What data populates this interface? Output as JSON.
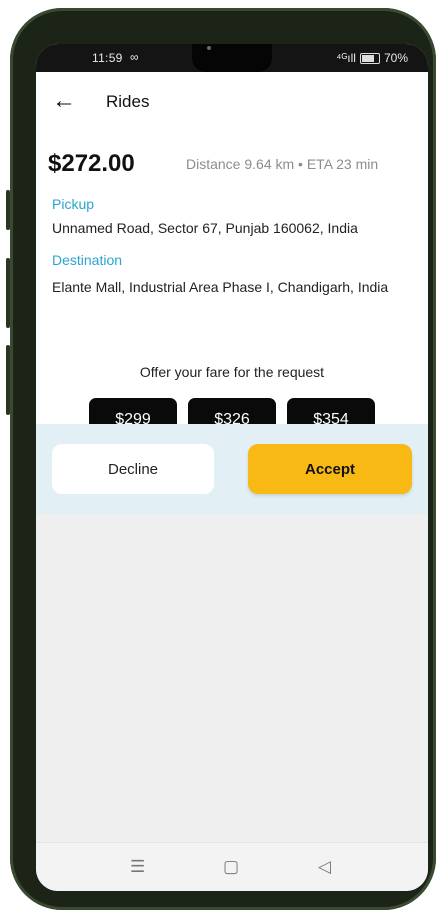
{
  "status_bar": {
    "time": "11:59",
    "extra": "∞",
    "signal": "⁴ᴳıll",
    "battery": "70%"
  },
  "header": {
    "title": "Rides"
  },
  "ride": {
    "price": "$272.00",
    "meta": "Distance 9.64 km • ETA 23 min",
    "pickup_label": "Pickup",
    "pickup_address": "Unnamed Road, Sector 67, Punjab 160062, India",
    "destination_label": "Destination",
    "destination_address": "Elante Mall, Industrial Area Phase I, Chandigarh, India"
  },
  "offer": {
    "prompt": "Offer your fare for the request",
    "options": [
      "$299",
      "$326",
      "$354"
    ]
  },
  "actions": {
    "decline": "Decline",
    "accept": "Accept"
  },
  "nav": {
    "menu": "☰",
    "home": "▢",
    "back": "◁"
  },
  "colors": {
    "accent": "#f9b914",
    "link": "#2aa6cf",
    "action_bg": "#e2f0f6"
  }
}
